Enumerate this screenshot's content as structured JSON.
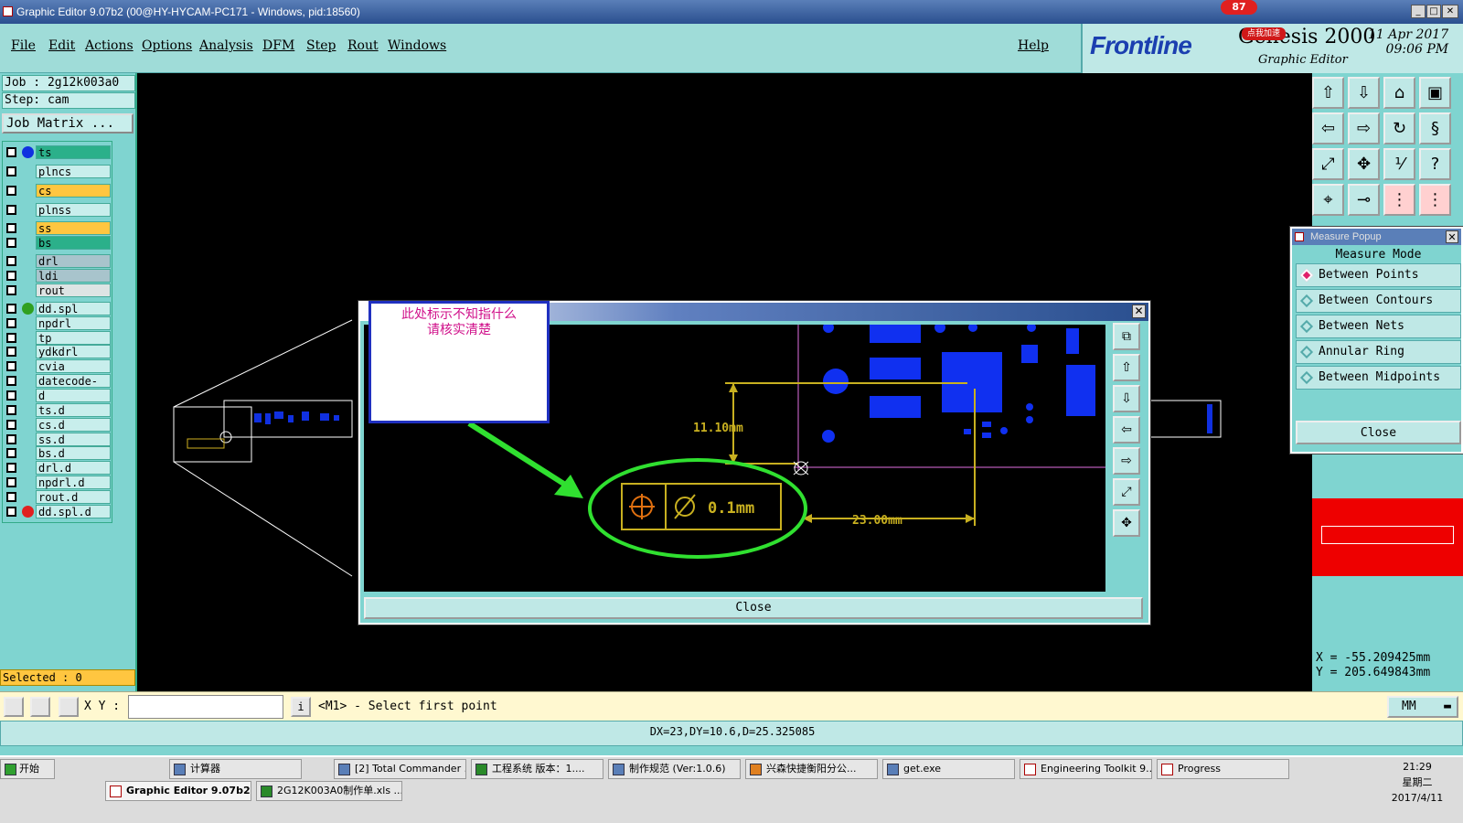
{
  "window": {
    "title": "Graphic Editor 9.07b2 (00@HY-HYCAM-PC171 - Windows, pid:18560)"
  },
  "menu": {
    "file": "File",
    "edit": "Edit",
    "actions": "Actions",
    "options": "Options",
    "analysis": "Analysis",
    "dfm": "DFM",
    "step": "Step",
    "rout": "Rout",
    "windows": "Windows",
    "help": "Help"
  },
  "logo": {
    "brand": "Frontline",
    "product": "Genesis 2000",
    "subtitle": "Graphic Editor",
    "date": "11 Apr 2017",
    "time": "09:06 PM"
  },
  "badge": {
    "count": "87",
    "speed_label": "点我加速"
  },
  "job": {
    "job_label": "Job : 2g12k003a0",
    "step_label": "Step: cam",
    "matrix_button": "Job Matrix ..."
  },
  "layers": [
    {
      "name": "ts",
      "color": "#2bb08a",
      "dot": "#1030e0"
    },
    {
      "name": "plncs",
      "color": "#c8eeec",
      "dot": ""
    },
    {
      "name": "cs",
      "color": "#ffc640",
      "dot": ""
    },
    {
      "name": "plnss",
      "color": "#c8eeec",
      "dot": ""
    },
    {
      "name": "ss",
      "color": "#ffc640",
      "dot": ""
    },
    {
      "name": "bs",
      "color": "#2bb08a",
      "dot": ""
    },
    {
      "name": "drl",
      "color": "#a8c4cc",
      "dot": ""
    },
    {
      "name": "ldi",
      "color": "#a8c4cc",
      "dot": ""
    },
    {
      "name": "rout",
      "color": "#dde4e4",
      "dot": ""
    },
    {
      "name": "dd.spl",
      "color": "#c8eeec",
      "dot": "#30a020"
    },
    {
      "name": "npdrl",
      "color": "#c8eeec",
      "dot": ""
    },
    {
      "name": "tp",
      "color": "#c8eeec",
      "dot": ""
    },
    {
      "name": "ydkdrl",
      "color": "#c8eeec",
      "dot": ""
    },
    {
      "name": "cvia",
      "color": "#c8eeec",
      "dot": ""
    },
    {
      "name": "datecode-ts",
      "color": "#c8eeec",
      "dot": ""
    },
    {
      "name": "d",
      "color": "#c8eeec",
      "dot": ""
    },
    {
      "name": "ts.d",
      "color": "#c8eeec",
      "dot": ""
    },
    {
      "name": "cs.d",
      "color": "#c8eeec",
      "dot": ""
    },
    {
      "name": "ss.d",
      "color": "#c8eeec",
      "dot": ""
    },
    {
      "name": "bs.d",
      "color": "#c8eeec",
      "dot": ""
    },
    {
      "name": "drl.d",
      "color": "#c8eeec",
      "dot": ""
    },
    {
      "name": "npdrl.d",
      "color": "#c8eeec",
      "dot": ""
    },
    {
      "name": "rout.d",
      "color": "#c8eeec",
      "dot": ""
    },
    {
      "name": "dd.spl.d",
      "color": "#c8eeec",
      "dot": "#e02020"
    }
  ],
  "selected": "Selected : 0",
  "measure": {
    "title": "Measure Popup",
    "mode_label": "Measure Mode",
    "options": [
      "Between Points",
      "Between Contours",
      "Between Nets",
      "Annular Ring",
      "Between Midpoints"
    ],
    "close": "Close"
  },
  "coords": {
    "x": "X = -55.209425mm",
    "y": "Y = 205.649843mm"
  },
  "zoom": {
    "close": "Close",
    "dim_vertical": "11.10mm",
    "dim_horizontal": "23.00mm",
    "tolerance": "0.1mm"
  },
  "note": {
    "line1": "此处标示不知指什么",
    "line2": "请核实清楚"
  },
  "cmd": {
    "xy_label": "X Y :",
    "xy_value": "",
    "prompt": "<M1> - Select first point",
    "units": "MM"
  },
  "status": {
    "text": "DX=23,DY=10.6,D=25.325085"
  },
  "taskbar": {
    "start": "开始",
    "items_row1": [
      "计算器",
      "[2] Total Commander ...",
      "工程系统  版本：1....",
      "制作规范 (Ver:1.0.6)",
      "兴森快捷衡阳分公...",
      "get.exe",
      "Engineering Toolkit 9....",
      "Progress"
    ],
    "items_row2": [
      "Graphic Editor 9.07b2 ...",
      "2G12K003A0制作单.xls ..."
    ],
    "clock_time": "21:29",
    "clock_day": "星期二",
    "clock_date": "2017/4/11"
  }
}
